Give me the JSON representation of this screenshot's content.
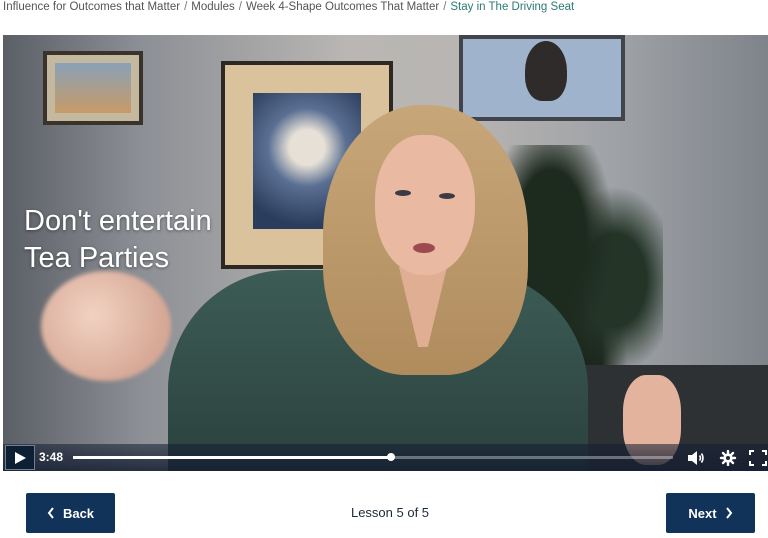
{
  "breadcrumb": {
    "items": [
      "Influence for Outcomes that Matter",
      "Modules",
      "Week 4-Shape Outcomes That Matter"
    ],
    "current": "Stay in The Driving Seat",
    "separator": "/"
  },
  "video": {
    "caption_line1": "Don't entertain",
    "caption_line2": "Tea Parties",
    "current_time": "3:48",
    "progress_fraction": 0.53,
    "icons": {
      "play": "play-icon",
      "volume": "volume-icon",
      "settings": "gear-icon",
      "fullscreen": "fullscreen-icon"
    }
  },
  "navigation": {
    "back_label": "Back",
    "next_label": "Next",
    "lesson_counter": "Lesson 5 of 5"
  },
  "colors": {
    "accent": "#2c7a72",
    "button_bg": "#113359",
    "controls_bg": "#0d1f33"
  }
}
